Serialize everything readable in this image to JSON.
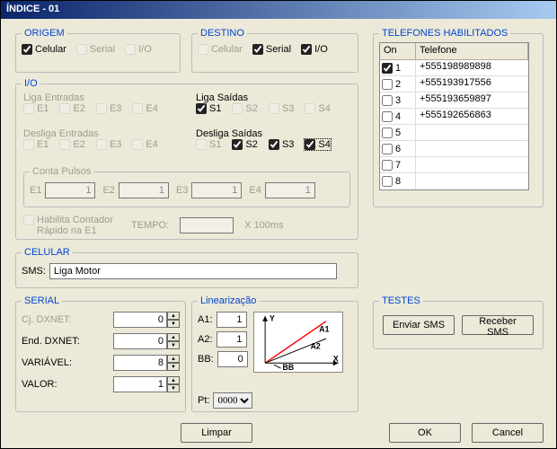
{
  "window": {
    "title": "ÍNDICE - 01"
  },
  "origem": {
    "legend": "ORIGEM",
    "celular": {
      "label": "Celular",
      "checked": true,
      "enabled": true
    },
    "serial": {
      "label": "Serial",
      "checked": false,
      "enabled": false
    },
    "io": {
      "label": "I/O",
      "checked": false,
      "enabled": false
    }
  },
  "destino": {
    "legend": "DESTINO",
    "celular": {
      "label": "Celular",
      "checked": false,
      "enabled": false
    },
    "serial": {
      "label": "Serial",
      "checked": true,
      "enabled": true
    },
    "io": {
      "label": "I/O",
      "checked": true,
      "enabled": true
    }
  },
  "io": {
    "legend": "I/O",
    "liga_entradas": {
      "label": "Liga Entradas",
      "items": [
        {
          "label": "E1",
          "checked": false
        },
        {
          "label": "E2",
          "checked": false
        },
        {
          "label": "E3",
          "checked": false
        },
        {
          "label": "E4",
          "checked": false
        }
      ],
      "enabled": false
    },
    "liga_saidas": {
      "label": "Liga Saídas",
      "items": [
        {
          "label": "S1",
          "checked": true,
          "enabled": true
        },
        {
          "label": "S2",
          "checked": false,
          "enabled": false
        },
        {
          "label": "S3",
          "checked": false,
          "enabled": false
        },
        {
          "label": "S4",
          "checked": false,
          "enabled": false
        }
      ]
    },
    "desliga_entradas": {
      "label": "Desliga Entradas",
      "items": [
        {
          "label": "E1",
          "checked": false
        },
        {
          "label": "E2",
          "checked": false
        },
        {
          "label": "E3",
          "checked": false
        },
        {
          "label": "E4",
          "checked": false
        }
      ],
      "enabled": false
    },
    "desliga_saidas": {
      "label": "Desliga Saídas",
      "items": [
        {
          "label": "S1",
          "checked": false,
          "enabled": false
        },
        {
          "label": "S2",
          "checked": true,
          "enabled": true
        },
        {
          "label": "S3",
          "checked": true,
          "enabled": true
        },
        {
          "label": "S4",
          "checked": true,
          "enabled": true,
          "focused": true
        }
      ]
    },
    "conta_pulsos": {
      "legend": "Conta Pulsos",
      "items": [
        {
          "label": "E1",
          "value": "1"
        },
        {
          "label": "E2",
          "value": "1"
        },
        {
          "label": "E3",
          "value": "1"
        },
        {
          "label": "E4",
          "value": "1"
        }
      ],
      "enabled": false
    },
    "hab_contador": {
      "label1": "Habilita Contador",
      "label2": "Rápido na E1",
      "checked": false,
      "enabled": false
    },
    "tempo": {
      "label": "TEMPO:",
      "suffix": "X 100ms",
      "value": "",
      "enabled": false
    }
  },
  "telefones": {
    "legend": "TELEFONES HABILITADOS",
    "col_on": "On",
    "col_tel": "Telefone",
    "rows": [
      {
        "n": "1",
        "on": true,
        "tel": "+555198989898"
      },
      {
        "n": "2",
        "on": false,
        "tel": "+555193917556"
      },
      {
        "n": "3",
        "on": false,
        "tel": "+555193659897"
      },
      {
        "n": "4",
        "on": false,
        "tel": "+555192656863"
      },
      {
        "n": "5",
        "on": false,
        "tel": ""
      },
      {
        "n": "6",
        "on": false,
        "tel": ""
      },
      {
        "n": "7",
        "on": false,
        "tel": ""
      },
      {
        "n": "8",
        "on": false,
        "tel": ""
      }
    ]
  },
  "celular": {
    "legend": "CELULAR",
    "sms_label": "SMS:",
    "sms_value": "Liga Motor"
  },
  "serial": {
    "legend": "SERIAL",
    "cj_dxnet": {
      "label": "Cj. DXNET:",
      "value": "0"
    },
    "end_dxnet": {
      "label": "End. DXNET:",
      "value": "0"
    },
    "variavel": {
      "label": "VARIÁVEL:",
      "value": "8"
    },
    "valor": {
      "label": "VALOR:",
      "value": "1"
    }
  },
  "linearizacao": {
    "legend": "Linearização",
    "a1": {
      "label": "A1:",
      "value": "1"
    },
    "a2": {
      "label": "A2:",
      "value": "1"
    },
    "bb": {
      "label": "BB:",
      "value": "0"
    },
    "pt": {
      "label": "Pt:",
      "value": "0000"
    },
    "labels": {
      "y": "Y",
      "x": "X",
      "a1": "A1",
      "a2": "A2",
      "bb": "BB"
    }
  },
  "testes": {
    "legend": "TESTES",
    "enviar": "Enviar SMS",
    "receber": "Receber SMS"
  },
  "buttons": {
    "limpar": "Limpar",
    "ok": "OK",
    "cancel": "Cancel"
  }
}
